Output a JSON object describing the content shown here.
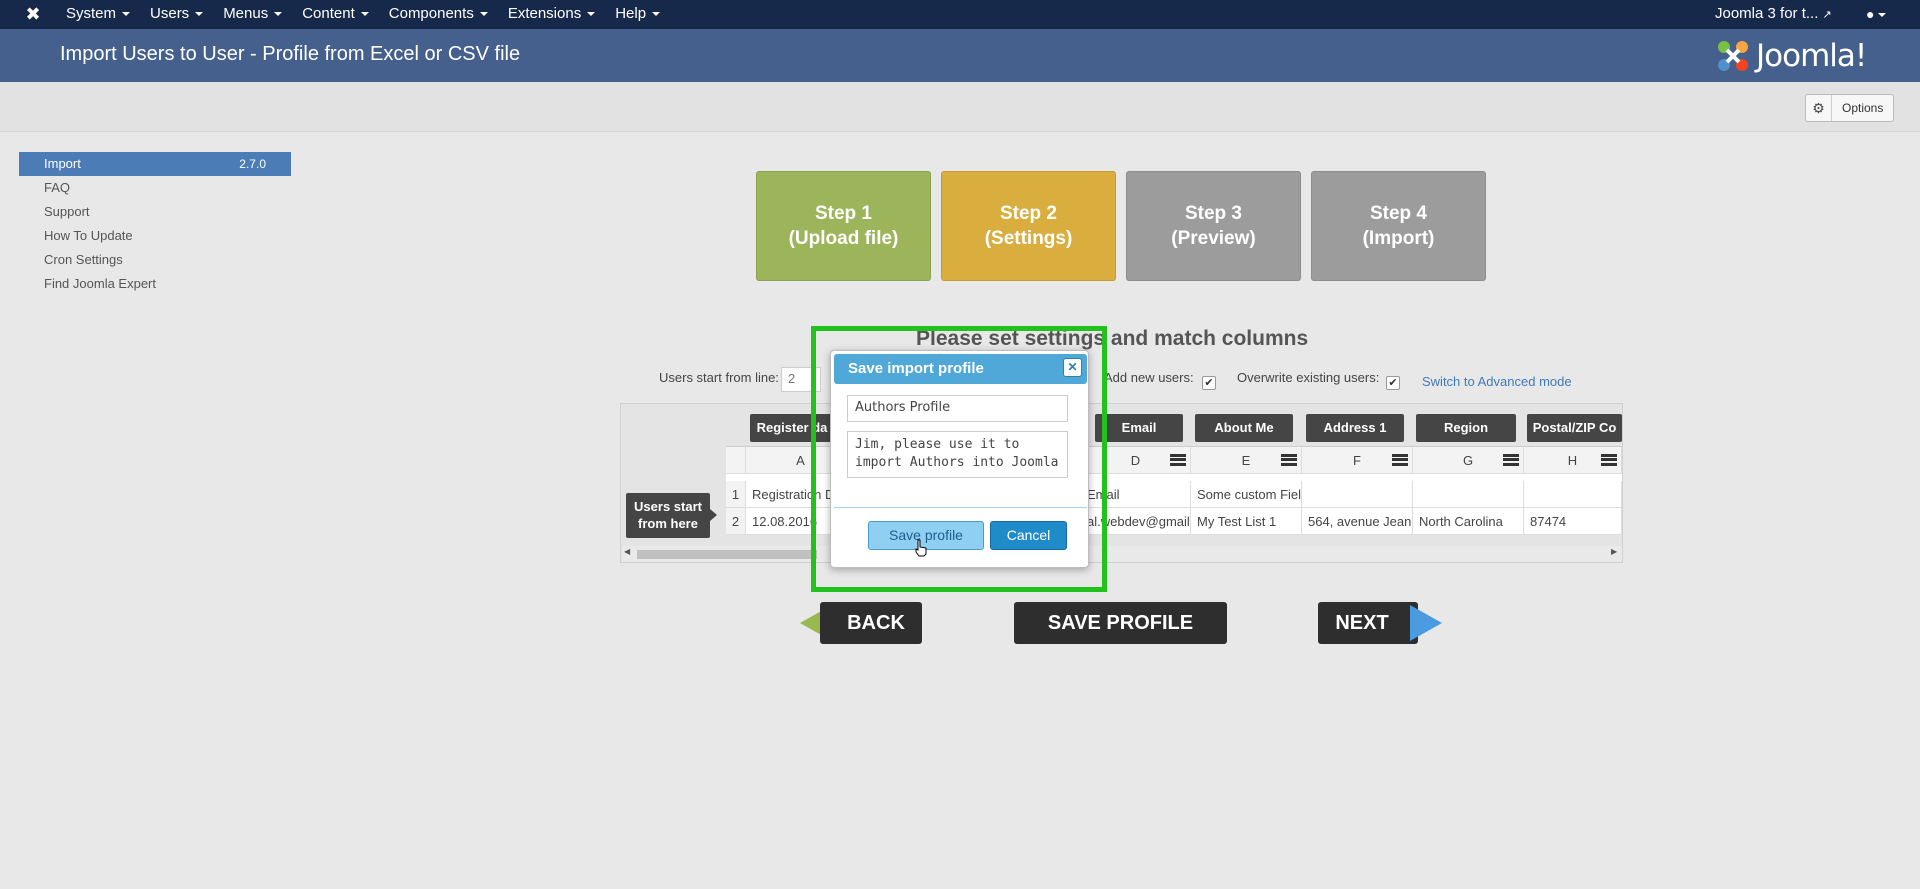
{
  "topbar": {
    "menu": [
      "System",
      "Users",
      "Menus",
      "Content",
      "Components",
      "Extensions",
      "Help"
    ],
    "site_link": "Joomla 3 for t...",
    "user_icon": "user-icon"
  },
  "header": {
    "title": "Import Users to User - Profile from Excel or CSV file",
    "brand": "Joomla!"
  },
  "toolbar": {
    "options_label": "Options"
  },
  "sidebar": {
    "items": [
      {
        "label": "Import",
        "version": "2.7.0"
      },
      {
        "label": "FAQ"
      },
      {
        "label": "Support"
      },
      {
        "label": "How To Update"
      },
      {
        "label": "Cron Settings"
      },
      {
        "label": "Find Joomla Expert"
      }
    ]
  },
  "steps": [
    {
      "line1": "Step 1",
      "line2": "(Upload file)"
    },
    {
      "line1": "Step 2",
      "line2": "(Settings)"
    },
    {
      "line1": "Step 3",
      "line2": "(Preview)"
    },
    {
      "line1": "Step 4",
      "line2": "(Import)"
    }
  ],
  "settings": {
    "title": "Please set settings and match columns",
    "start_line_label": "Users start from line:",
    "start_line_value": "2",
    "add_new_label": "Add new users:",
    "overwrite_label": "Overwrite existing users:",
    "advanced_link": "Switch to Advanced mode"
  },
  "grid": {
    "tags": [
      "Register da",
      "Email",
      "About Me",
      "Address 1",
      "Region",
      "Postal/ZIP Co"
    ],
    "col_letters": [
      "A",
      "D",
      "E",
      "F",
      "G",
      "H"
    ],
    "row_numbers": [
      "1",
      "2"
    ],
    "row1": [
      "Registration D",
      "Email",
      "Some custom Fiel",
      "",
      "",
      ""
    ],
    "row2": [
      "12.08.2016",
      "al.webdev@gmail",
      "My Test List 1",
      "564, avenue Jean",
      "North Carolina",
      "87474"
    ],
    "users_start_label": "Users start from here"
  },
  "buttons": {
    "back": "BACK",
    "save_profile": "SAVE PROFILE",
    "next": "NEXT"
  },
  "dialog": {
    "title": "Save import profile",
    "name_value": "Authors Profile",
    "description_value": "Jim, please use it to import Authors into Joomla",
    "save_label": "Save profile",
    "cancel_label": "Cancel"
  }
}
